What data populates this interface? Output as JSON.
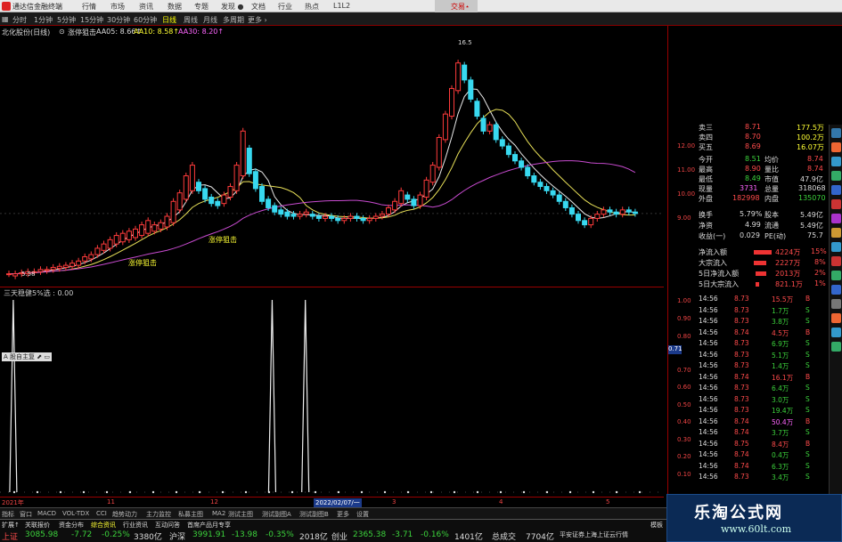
{
  "app": {
    "title": "通达信金融终端",
    "brand": "交易⋆"
  },
  "menu": [
    "行情",
    "市场",
    "资讯",
    "数据",
    "专题",
    "发现 ●",
    "文档",
    "行业",
    "热点",
    "L1L2"
  ],
  "periods": {
    "items": [
      "分时",
      "1分钟",
      "5分钟",
      "15分钟",
      "30分钟",
      "60分钟",
      "日线",
      "周线",
      "月线",
      "多周期",
      "更多 ›"
    ],
    "selected": "日线"
  },
  "stock_line": {
    "name": "北化股份(日线)",
    "sub": "⊙",
    "indicator": "涨停狙击",
    "aa5": "AA05: 8.66↑",
    "aa10": "AA10: 8.58↑",
    "aa30": "AA30: 8.20↑"
  },
  "chart_data": {
    "type": "candlestick",
    "title": "",
    "high_label": "16.5",
    "low_label": "5.58",
    "annotations": [
      "涨停狙击",
      "涨停狙击"
    ],
    "y_axis_ticks": [
      "12.00",
      "11.00",
      "10.00",
      "9.00"
    ],
    "candles": [
      [
        5.9,
        5.9
      ],
      [
        5.8,
        5.9
      ],
      [
        5.9,
        5.95
      ],
      [
        5.9,
        6.0
      ],
      [
        6.0,
        6.0
      ],
      [
        6.0,
        6.1
      ],
      [
        6.05,
        6.1
      ],
      [
        6.1,
        6.2
      ],
      [
        6.15,
        6.25
      ],
      [
        6.2,
        6.3
      ],
      [
        6.25,
        6.4
      ],
      [
        6.3,
        6.5
      ],
      [
        6.5,
        6.7
      ],
      [
        6.6,
        6.8
      ],
      [
        6.8,
        7.1
      ],
      [
        7.0,
        7.3
      ],
      [
        7.1,
        7.5
      ],
      [
        7.3,
        7.7
      ],
      [
        7.4,
        7.8
      ],
      [
        7.5,
        7.9
      ],
      [
        7.6,
        8.0
      ],
      [
        7.7,
        8.2
      ],
      [
        7.8,
        8.4
      ],
      [
        7.9,
        8.2
      ],
      [
        8.0,
        8.3
      ],
      [
        8.1,
        8.6
      ],
      [
        8.3,
        9.3
      ],
      [
        8.9,
        9.7
      ],
      [
        9.4,
        10.5
      ],
      [
        9.8,
        11.0
      ],
      [
        10.2,
        9.8
      ],
      [
        9.9,
        9.4
      ],
      [
        9.5,
        9.2
      ],
      [
        9.3,
        9.1
      ],
      [
        9.2,
        9.6
      ],
      [
        9.5,
        10.0
      ],
      [
        9.8,
        11.0
      ],
      [
        10.5,
        12.6
      ],
      [
        11.8,
        10.6
      ],
      [
        10.7,
        9.9
      ],
      [
        10.0,
        9.3
      ],
      [
        9.4,
        9.0
      ],
      [
        9.1,
        8.8
      ],
      [
        8.9,
        8.7
      ],
      [
        8.8,
        8.6
      ],
      [
        8.7,
        8.6
      ],
      [
        8.6,
        8.7
      ],
      [
        8.7,
        8.8
      ],
      [
        8.7,
        8.6
      ],
      [
        8.6,
        8.5
      ],
      [
        8.5,
        8.6
      ],
      [
        8.6,
        8.5
      ],
      [
        8.5,
        8.4
      ],
      [
        8.4,
        8.5
      ],
      [
        8.5,
        8.6
      ],
      [
        8.6,
        8.5
      ],
      [
        8.5,
        8.4
      ],
      [
        8.4,
        8.5
      ],
      [
        8.5,
        8.6
      ],
      [
        8.6,
        8.7
      ],
      [
        8.7,
        9.0
      ],
      [
        8.9,
        9.3
      ],
      [
        9.2,
        9.8
      ],
      [
        9.6,
        9.4
      ],
      [
        9.4,
        9.1
      ],
      [
        9.1,
        9.6
      ],
      [
        9.5,
        10.3
      ],
      [
        10.2,
        11.0
      ],
      [
        10.9,
        12.3
      ],
      [
        12.2,
        13.4
      ],
      [
        13.3,
        14.6
      ],
      [
        14.5,
        15.8
      ],
      [
        15.7,
        15.0
      ],
      [
        15.0,
        14.1
      ],
      [
        14.0,
        13.3
      ],
      [
        13.2,
        12.6
      ],
      [
        12.6,
        12.9
      ],
      [
        12.9,
        12.2
      ],
      [
        12.2,
        11.9
      ],
      [
        11.9,
        11.5
      ],
      [
        11.5,
        11.2
      ],
      [
        11.2,
        10.9
      ],
      [
        10.9,
        10.5
      ],
      [
        10.5,
        10.2
      ],
      [
        10.2,
        10.0
      ],
      [
        10.0,
        9.8
      ],
      [
        9.8,
        9.6
      ],
      [
        9.6,
        9.3
      ],
      [
        9.3,
        9.0
      ],
      [
        9.0,
        8.7
      ],
      [
        8.7,
        8.4
      ],
      [
        8.4,
        8.2
      ],
      [
        8.2,
        8.5
      ],
      [
        8.5,
        8.7
      ],
      [
        8.7,
        8.9
      ],
      [
        8.9,
        8.8
      ],
      [
        8.8,
        8.7
      ],
      [
        8.7,
        8.9
      ],
      [
        8.9,
        8.8
      ],
      [
        8.8,
        8.73
      ]
    ]
  },
  "sub_chart": {
    "title": "三天稳健5%选 : 0.00",
    "axis": [
      "1.00",
      "0.90",
      "0.80",
      "0.70",
      "0.60",
      "0.50",
      "0.40",
      "0.30",
      "0.20",
      "0.10"
    ],
    "value_box": "0.71",
    "label": "A 股自主复 ⬈ ▭",
    "spikes": [
      0.02,
      0.41,
      0.46
    ]
  },
  "date_axis": {
    "start": "2021年",
    "selected": "2022/02/07/一",
    "marks": [
      "11",
      "12",
      "3",
      "4",
      "5"
    ]
  },
  "quote": {
    "asks": [
      {
        "label": "卖三",
        "price": "8.71",
        "vol": "177.5万"
      },
      {
        "label": "卖四",
        "price": "8.70",
        "vol": "100.2万"
      },
      {
        "label": "买五",
        "price": "8.69",
        "vol": "16.07万"
      }
    ],
    "stats": [
      {
        "l1": "今开",
        "v1": "8.51",
        "l2": "均价",
        "v2": "8.74"
      },
      {
        "l1": "最高",
        "v1": "8.90",
        "l2": "量比",
        "v2": "8.74"
      },
      {
        "l1": "最低",
        "v1": "8.49",
        "l2": "市值",
        "v2": "47.9亿"
      },
      {
        "l1": "现量",
        "v1": "3731",
        "l2": "总量",
        "v2": "318068"
      },
      {
        "l1": "外盘",
        "v1": "182998",
        "l2": "内盘",
        "v2": "135070"
      },
      {
        "l1": "换手",
        "v1": "5.79%",
        "l2": "股本",
        "v2": "5.49亿"
      },
      {
        "l1": "净资",
        "v1": "4.99",
        "l2": "流通",
        "v2": "5.49亿"
      },
      {
        "l1": "收益(一)",
        "v1": "0.029",
        "l2": "PE(动)",
        "v2": "75.7"
      }
    ],
    "flows": [
      {
        "label": "净流入额",
        "val": "4224万",
        "pct": "15%"
      },
      {
        "label": "大宗流入",
        "val": "2227万",
        "pct": "8%"
      },
      {
        "label": "5日净流入额",
        "val": "2013万",
        "pct": "2%"
      },
      {
        "label": "5日大宗流入",
        "val": "821.1万",
        "pct": "1%"
      }
    ]
  },
  "ticks": [
    {
      "t": "14:56",
      "p": "8.73",
      "v": "15.5万",
      "d": "B"
    },
    {
      "t": "14:56",
      "p": "8.73",
      "v": "1.7万",
      "d": "S"
    },
    {
      "t": "14:56",
      "p": "8.73",
      "v": "3.8万",
      "d": "S"
    },
    {
      "t": "14:56",
      "p": "8.74",
      "v": "4.5万",
      "d": "B"
    },
    {
      "t": "14:56",
      "p": "8.73",
      "v": "6.9万",
      "d": "S"
    },
    {
      "t": "14:56",
      "p": "8.73",
      "v": "5.1万",
      "d": "S"
    },
    {
      "t": "14:56",
      "p": "8.73",
      "v": "1.4万",
      "d": "S"
    },
    {
      "t": "14:56",
      "p": "8.74",
      "v": "16.1万",
      "d": "B"
    },
    {
      "t": "14:56",
      "p": "8.73",
      "v": "6.4万",
      "d": "S"
    },
    {
      "t": "14:56",
      "p": "8.73",
      "v": "3.0万",
      "d": "S"
    },
    {
      "t": "14:56",
      "p": "8.73",
      "v": "19.4万",
      "d": "S"
    },
    {
      "t": "14:56",
      "p": "8.74",
      "v": "50.4万",
      "d": "B"
    },
    {
      "t": "14:56",
      "p": "8.74",
      "v": "3.7万",
      "d": "S"
    },
    {
      "t": "14:56",
      "p": "8.75",
      "v": "8.4万",
      "d": "B"
    },
    {
      "t": "14:56",
      "p": "8.74",
      "v": "0.4万",
      "d": "S"
    },
    {
      "t": "14:56",
      "p": "8.74",
      "v": "6.3万",
      "d": "S"
    },
    {
      "t": "14:56",
      "p": "8.73",
      "v": "3.4万",
      "d": "S"
    }
  ],
  "tabs": [
    "指标",
    "窗口",
    "MACD",
    "VOL-TDX",
    "CCI",
    "趋势动力",
    "主力监控",
    "私募主图",
    "MA2",
    "测试主图",
    "测试副图A",
    "测试副图B",
    "更多",
    "设置"
  ],
  "tabs2": [
    "扩展↑",
    "关联报价",
    "资金分布",
    "综合资讯",
    "行业资讯",
    "互动问答",
    "首席产品月专享"
  ],
  "status": {
    "sh_label": "上证",
    "sh": "3085.98",
    "sh_chg": "-7.72",
    "sh_pct": "-0.25%",
    "sh_amt": "3380亿",
    "sz_label": "沪深",
    "sz": "3991.91",
    "sz_chg": "-13.98",
    "sz_pct": "-0.35%",
    "sz_amt": "2018亿",
    "cy_label": "创业",
    "cy": "2365.38",
    "cy_chg": "-3.71",
    "cy_pct": "-0.16%",
    "cy_amt": "1401亿",
    "total_label": "总成交",
    "total": "7704亿",
    "right": "平安证券上海上证云行情",
    "panel_right": "模板"
  },
  "watermark": {
    "line1": "乐淘公式网",
    "line2": "www.60lt.com"
  }
}
